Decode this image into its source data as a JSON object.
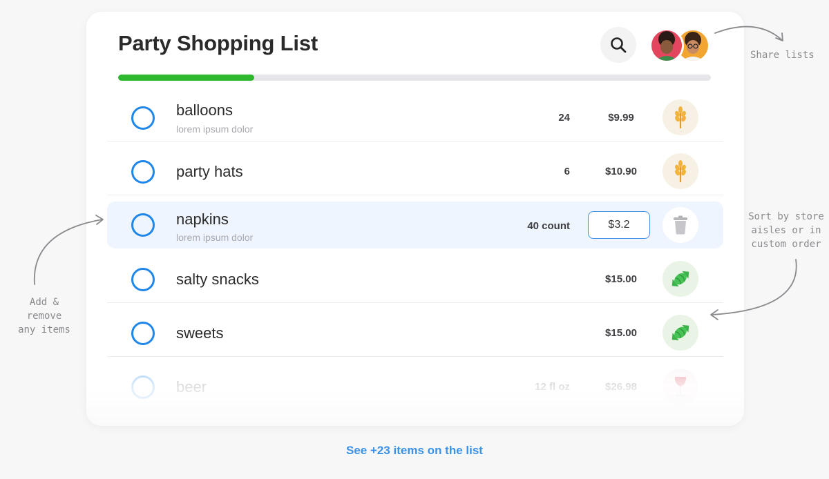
{
  "header": {
    "title": "Party Shopping List",
    "search_icon": "search-icon",
    "avatars": [
      {
        "name": "user-avatar-1"
      },
      {
        "name": "user-avatar-2"
      }
    ]
  },
  "progress": {
    "fraction": 0.23,
    "color": "#2eb82e"
  },
  "items": [
    {
      "name": "balloons",
      "sub": "lorem ipsum dolor",
      "qty": "24",
      "price": "$9.99",
      "category_icon": "wheat-icon"
    },
    {
      "name": "party hats",
      "sub": "",
      "qty": "6",
      "price": "$10.90",
      "category_icon": "wheat-icon"
    },
    {
      "name": "napkins",
      "sub": "lorem ipsum dolor",
      "qty": "40 count",
      "price": "$3.2",
      "category_icon": "trash-icon",
      "selected": true
    },
    {
      "name": "salty snacks",
      "sub": "",
      "qty": "",
      "price": "$15.00",
      "category_icon": "candy-icon"
    },
    {
      "name": "sweets",
      "sub": "",
      "qty": "",
      "price": "$15.00",
      "category_icon": "candy-icon"
    },
    {
      "name": "beer",
      "sub": "",
      "qty": "12 fl oz",
      "price": "$26.98",
      "category_icon": "wine-glass-icon"
    }
  ],
  "footer": {
    "see_more": "See +23 items on the list"
  },
  "annotations": {
    "share": "Share lists",
    "add_remove": [
      "Add &",
      "remove",
      "any items"
    ],
    "sort": [
      "Sort by store",
      "aisles or in",
      "custom order"
    ]
  },
  "colors": {
    "accent": "#1f86ea",
    "link": "#3a91e8",
    "progress": "#2eb82e"
  }
}
